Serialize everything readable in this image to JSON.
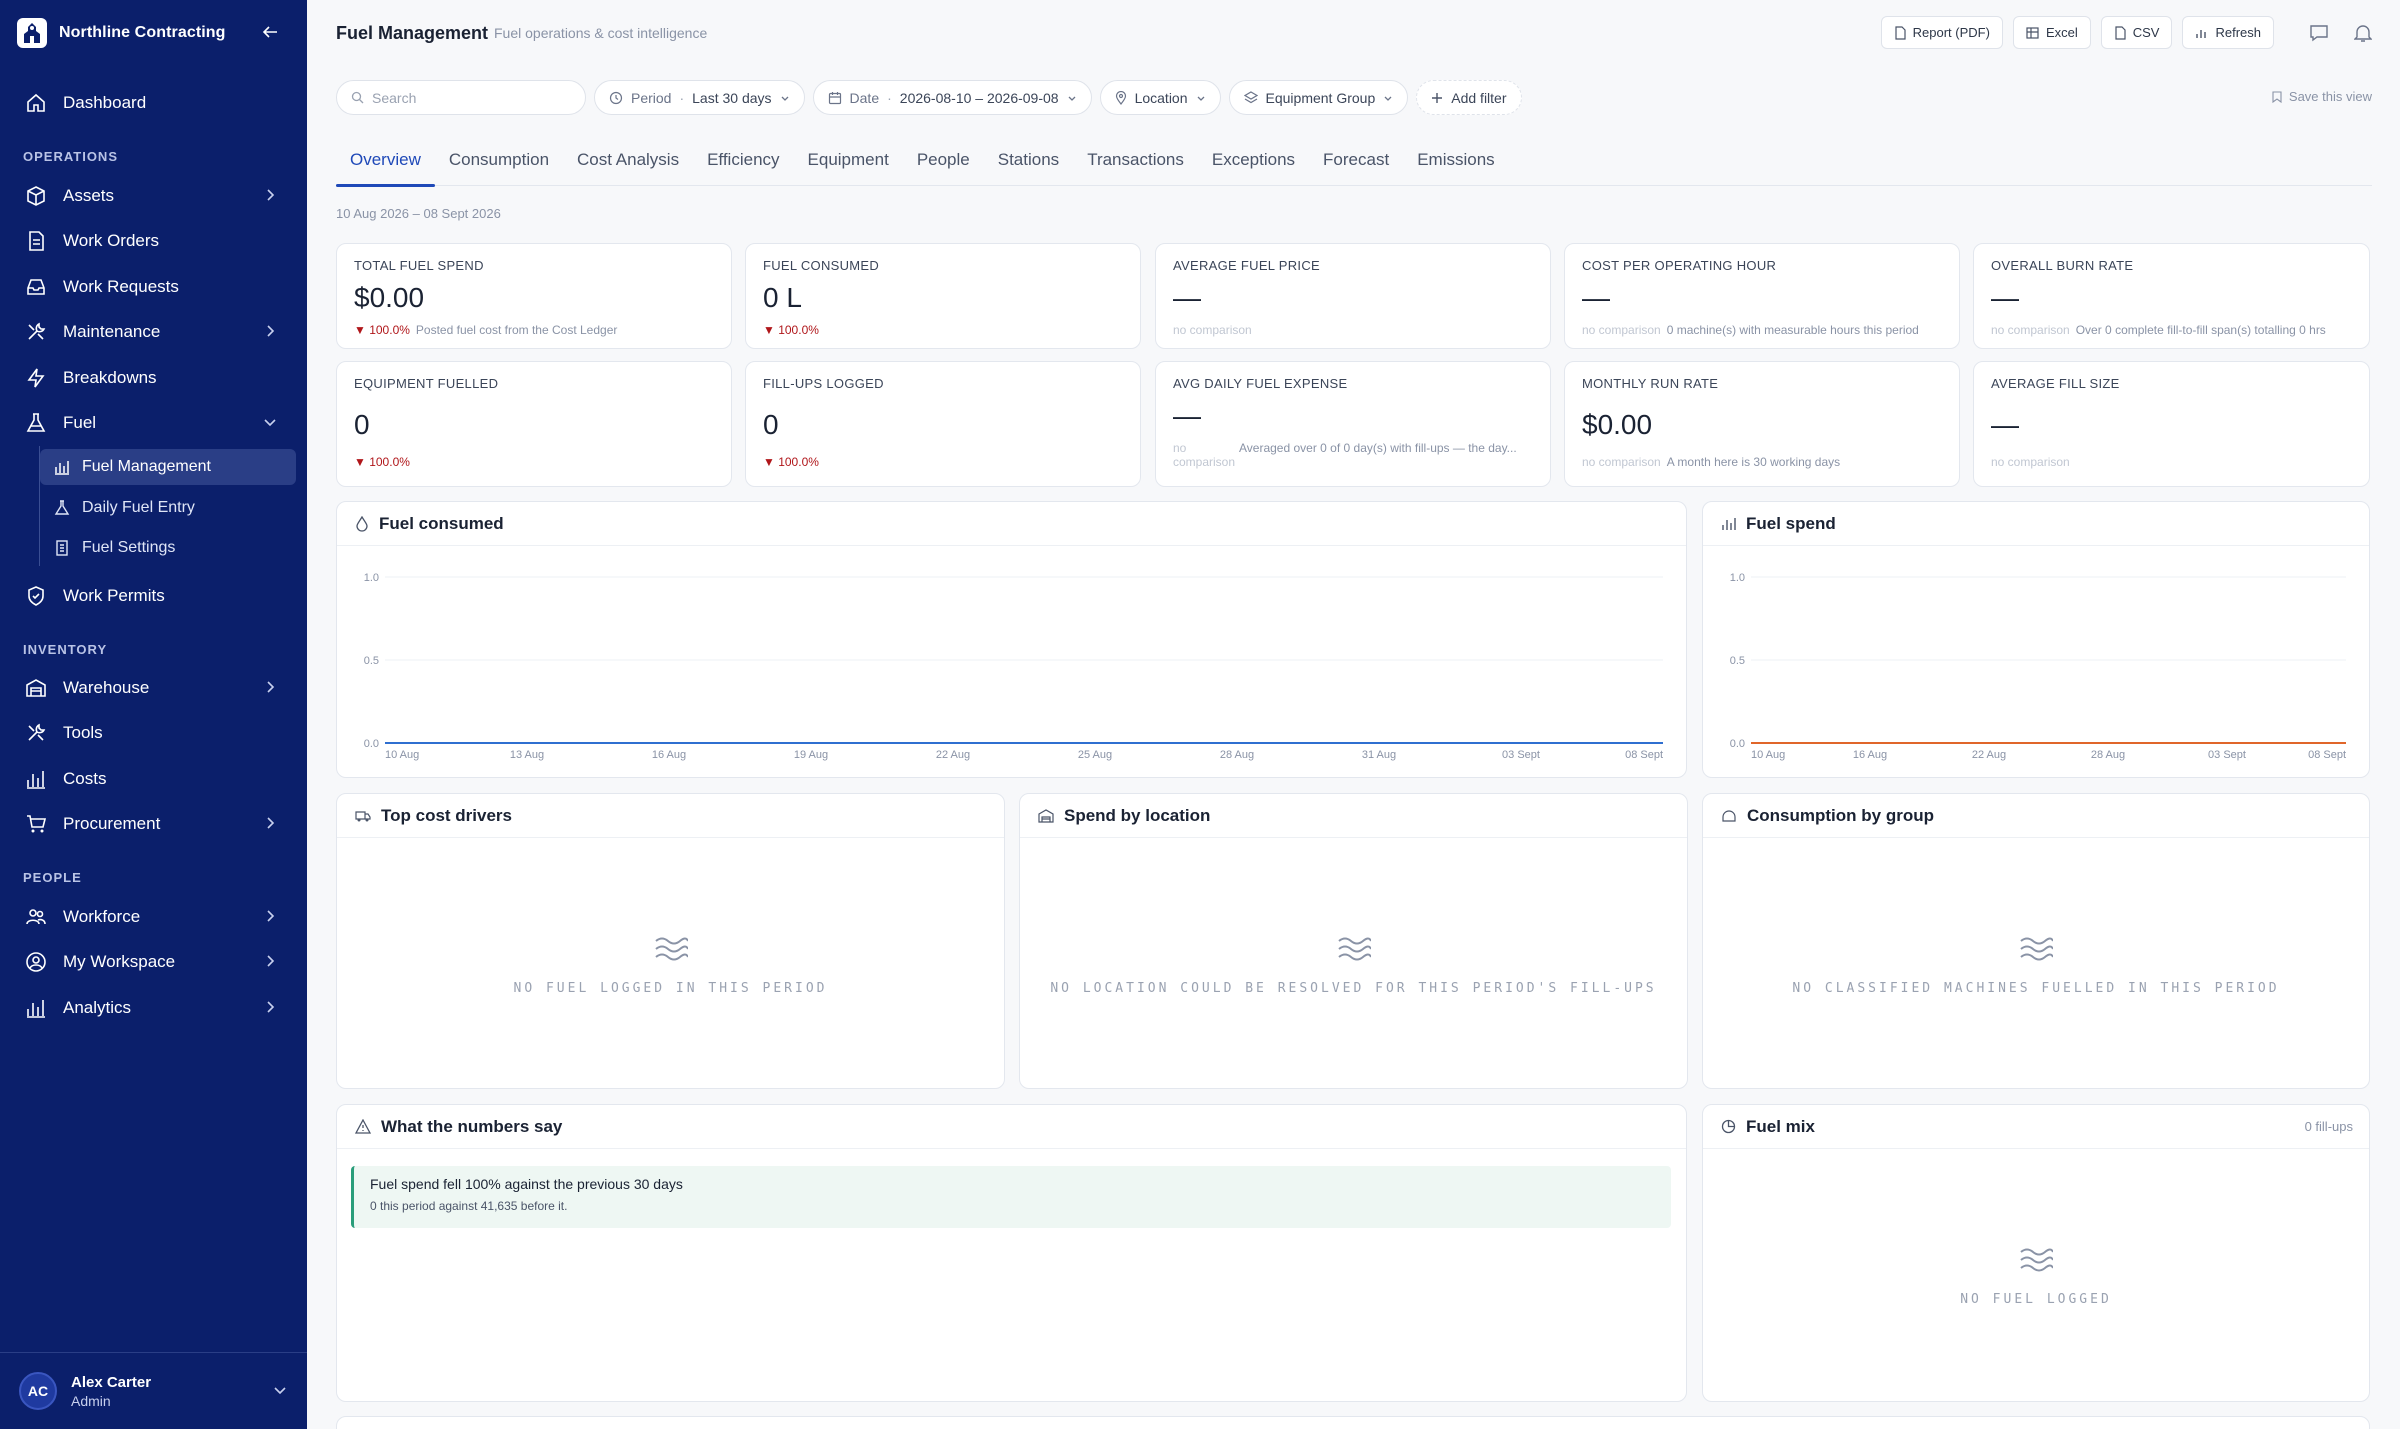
{
  "brand": {
    "name": "Northline Contracting"
  },
  "sidebar": {
    "dashboard": "Dashboard",
    "sections": {
      "operations": "OPERATIONS",
      "inventory": "INVENTORY",
      "people": "PEOPLE"
    },
    "items": {
      "assets": "Assets",
      "work_orders": "Work Orders",
      "work_requests": "Work Requests",
      "maintenance": "Maintenance",
      "breakdowns": "Breakdowns",
      "fuel": "Fuel",
      "fuel_management": "Fuel Management",
      "daily_fuel_entry": "Daily Fuel Entry",
      "fuel_settings": "Fuel Settings",
      "work_permits": "Work Permits",
      "warehouse": "Warehouse",
      "tools": "Tools",
      "costs": "Costs",
      "procurement": "Procurement",
      "workforce": "Workforce",
      "my_workspace": "My Workspace",
      "analytics": "Analytics"
    },
    "user": {
      "initials": "AC",
      "name": "Alex Carter",
      "role": "Admin"
    }
  },
  "header": {
    "title": "Fuel Management",
    "subtitle": "Fuel operations & cost intelligence",
    "actions": {
      "report": "Report (PDF)",
      "excel": "Excel",
      "csv": "CSV",
      "refresh": "Refresh"
    }
  },
  "filters": {
    "search_placeholder": "Search",
    "period_label": "Period",
    "period_value": "Last 30 days",
    "date_label": "Date",
    "date_value": "2026-08-10 – 2026-09-08",
    "location": "Location",
    "equipment_group": "Equipment Group",
    "add_filter": "Add filter",
    "save_view": "Save this view"
  },
  "tabs": [
    "Overview",
    "Consumption",
    "Cost Analysis",
    "Efficiency",
    "Equipment",
    "People",
    "Stations",
    "Transactions",
    "Exceptions",
    "Forecast",
    "Emissions"
  ],
  "active_tab": "Overview",
  "range_label": "10 Aug 2026 – 08 Sept 2026",
  "kpis": [
    {
      "label": "TOTAL FUEL SPEND",
      "value": "$0.00",
      "delta": "▼ 100.0%",
      "note": "Posted fuel cost from the Cost Ledger"
    },
    {
      "label": "FUEL CONSUMED",
      "value": "0 L",
      "delta": "▼ 100.0%",
      "note": ""
    },
    {
      "label": "AVERAGE FUEL PRICE",
      "value": "—",
      "delta": "no comparison",
      "note": ""
    },
    {
      "label": "COST PER OPERATING HOUR",
      "value": "—",
      "delta": "no comparison",
      "note": "0 machine(s) with measurable hours this period"
    },
    {
      "label": "OVERALL BURN RATE",
      "value": "—",
      "delta": "no comparison",
      "note": "Over 0 complete fill-to-fill span(s) totalling 0 hrs"
    },
    {
      "label": "EQUIPMENT FUELLED",
      "value": "0",
      "delta": "▼ 100.0%",
      "note": ""
    },
    {
      "label": "FILL-UPS LOGGED",
      "value": "0",
      "delta": "▼ 100.0%",
      "note": ""
    },
    {
      "label": "AVG DAILY FUEL EXPENSE",
      "value": "—",
      "delta": "no comparison",
      "note": "Averaged over 0 of 0 day(s) with fill-ups — the day..."
    },
    {
      "label": "MONTHLY RUN RATE",
      "value": "$0.00",
      "delta": "no comparison",
      "note": "A month here is 30 working days"
    },
    {
      "label": "AVERAGE FILL SIZE",
      "value": "—",
      "delta": "no comparison",
      "note": ""
    }
  ],
  "cards": {
    "fuel_consumed": "Fuel consumed",
    "fuel_spend": "Fuel spend",
    "top_cost_drivers": "Top cost drivers",
    "top_cost_drivers_empty": "NO FUEL LOGGED IN THIS PERIOD",
    "spend_by_location": "Spend by location",
    "spend_by_location_empty": "NO LOCATION COULD BE RESOLVED FOR THIS PERIOD'S FILL-UPS",
    "consumption_by_group": "Consumption by group",
    "consumption_by_group_empty": "NO CLASSIFIED MACHINES FUELLED IN THIS PERIOD",
    "what_numbers_say": "What the numbers say",
    "insight_title": "Fuel spend fell 100% against the previous 30 days",
    "insight_body": "0 this period against 41,635 before it.",
    "fuel_mix": "Fuel mix",
    "fuel_mix_count": "0 fill-ups",
    "fuel_mix_empty": "NO FUEL LOGGED"
  },
  "colors": {
    "consumed_line": "#2f6fd0",
    "spend_line": "#e0662a",
    "sidebar": "#0b1f6b",
    "accent": "#1f49b8",
    "delta_down": "#b0161a"
  },
  "chart_data": [
    {
      "type": "line",
      "title": "Fuel consumed",
      "x_ticks": [
        "10 Aug",
        "13 Aug",
        "16 Aug",
        "19 Aug",
        "22 Aug",
        "25 Aug",
        "28 Aug",
        "31 Aug",
        "03 Sept",
        "08 Sept"
      ],
      "y_ticks": [
        "1.0",
        "0.5",
        "0.0"
      ],
      "ylim": [
        0,
        1
      ],
      "series": [
        {
          "values": [
            0,
            0,
            0,
            0,
            0,
            0,
            0,
            0,
            0,
            0
          ]
        }
      ],
      "grid": true
    },
    {
      "type": "line",
      "title": "Fuel spend",
      "x_ticks": [
        "10 Aug",
        "16 Aug",
        "22 Aug",
        "28 Aug",
        "03 Sept",
        "08 Sept"
      ],
      "y_ticks": [
        "1.0",
        "0.5",
        "0.0"
      ],
      "ylim": [
        0,
        1
      ],
      "series": [
        {
          "values": [
            0,
            0,
            0,
            0,
            0,
            0
          ]
        }
      ],
      "grid": true
    }
  ]
}
